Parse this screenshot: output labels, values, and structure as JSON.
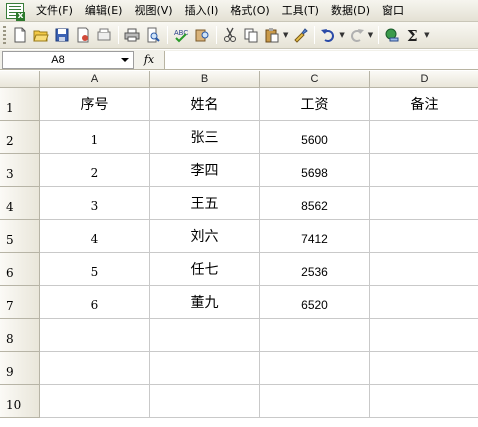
{
  "menu": {
    "items": [
      "文件(F)",
      "编辑(E)",
      "视图(V)",
      "插入(I)",
      "格式(O)",
      "工具(T)",
      "数据(D)",
      "窗口"
    ]
  },
  "toolbar": {
    "buttons": [
      "new-icon",
      "open-icon",
      "save-icon",
      "permission-icon",
      "print-icon",
      "print-preview-icon",
      "spelling-icon",
      "research-icon",
      "cut-icon",
      "copy-icon",
      "paste-icon",
      "format-painter-icon",
      "undo-icon",
      "redo-icon",
      "hyperlink-icon",
      "autosum-icon"
    ]
  },
  "formula_bar": {
    "name_box": "A8",
    "fx_label": "fx",
    "content": ""
  },
  "sheet": {
    "columns": [
      "A",
      "B",
      "C",
      "D"
    ],
    "rows": [
      "1",
      "2",
      "3",
      "4",
      "5",
      "6",
      "7",
      "8",
      "9",
      "10"
    ],
    "cells": [
      [
        "序号",
        "姓名",
        "工资",
        "备注"
      ],
      [
        "1",
        "张三",
        "5600",
        ""
      ],
      [
        "2",
        "李四",
        "5698",
        ""
      ],
      [
        "3",
        "王五",
        "8562",
        ""
      ],
      [
        "4",
        "刘六",
        "7412",
        ""
      ],
      [
        "5",
        "任七",
        "2536",
        ""
      ],
      [
        "6",
        "董九",
        "6520",
        ""
      ],
      [
        "",
        "",
        "",
        ""
      ],
      [
        "",
        "",
        "",
        ""
      ],
      [
        "",
        "",
        "",
        ""
      ]
    ]
  }
}
